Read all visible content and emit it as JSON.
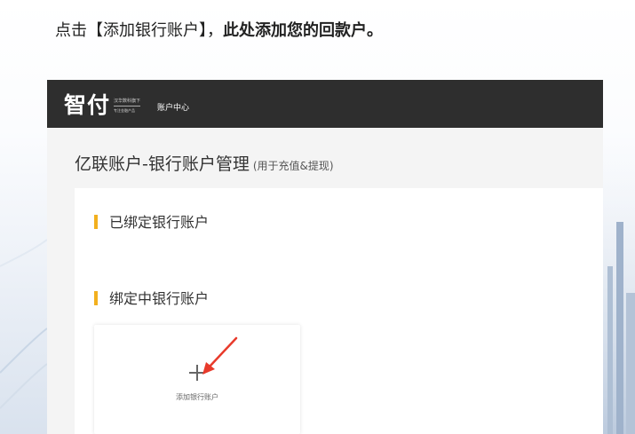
{
  "instruction": {
    "prefix": "点击【添加银行账户】，",
    "emphasis": "此处添加您的回款户。"
  },
  "header": {
    "logo": "智付",
    "logo_tagline_1": "汉华数科旗下",
    "logo_tagline_2": "专注金融产品",
    "center_label": "账户中心"
  },
  "page": {
    "title": "亿联账户-银行账户管理",
    "title_note": "(用于充值&提现)"
  },
  "sections": {
    "bound": "已绑定银行账户",
    "binding": "绑定中银行账户"
  },
  "add_card": {
    "icon": "plus-icon",
    "label": "添加银行账户"
  },
  "colors": {
    "topbar": "#2e2e2e",
    "accent": "#f2b01e",
    "annotation_arrow": "#e83a2b"
  }
}
